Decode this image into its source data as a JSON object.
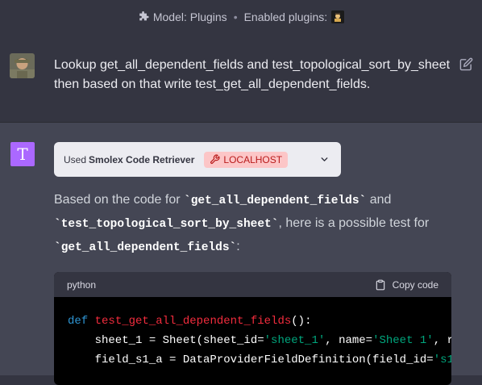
{
  "header": {
    "model_label": "Model: Plugins",
    "separator": "•",
    "enabled_label": "Enabled plugins:"
  },
  "user_message": {
    "text": "Lookup get_all_dependent_fields and test_topological_sort_by_sheet then based on that write test_get_all_dependent_fields."
  },
  "assistant": {
    "avatar_letter": "T",
    "plugin": {
      "used_label": "Used",
      "name": "Smolex Code Retriever",
      "badge": "LOCALHOST"
    },
    "answer": {
      "part1": "Based on the code for ",
      "code1": "`get_all_dependent_fields`",
      "part2": " and ",
      "code2": "`test_topological_sort_by_sheet`",
      "part3": ", here is a possible test for ",
      "code3": "`get_all_dependent_fields`",
      "part4": ":"
    },
    "code_block": {
      "language": "python",
      "copy_label": "Copy code",
      "line1": {
        "kw": "def",
        "sp": " ",
        "fn": "test_get_all_dependent_fields",
        "rest": "():"
      },
      "line2": {
        "a": "    sheet_1 = Sheet(sheet_id=",
        "s1": "'sheet_1'",
        "b": ", name=",
        "s2": "'Sheet 1'",
        "c": ", r"
      },
      "line3": {
        "a": "    field_s1_a = DataProviderFieldDefinition(field_id=",
        "s1": "'s1"
      }
    }
  },
  "colors": {
    "background": "#343541",
    "assistant_bg": "#444654",
    "assistant_avatar": "#ab68ff",
    "badge_bg": "#fcc6c7",
    "badge_text": "#b91c1c"
  }
}
